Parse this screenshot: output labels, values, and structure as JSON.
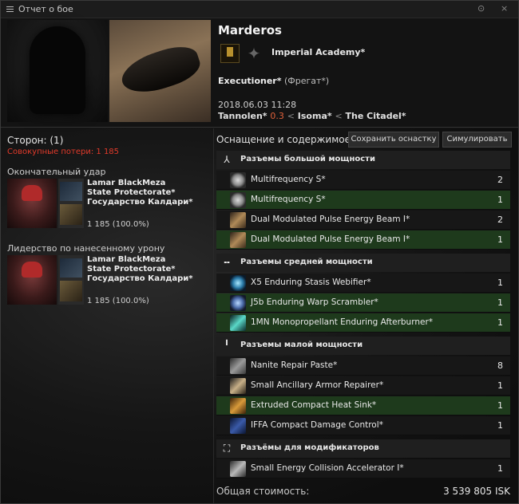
{
  "window": {
    "title": "Отчет о бое",
    "ctl1": "⊙",
    "ctl2": "×"
  },
  "victim": {
    "name": "Marderos",
    "corporation": "Imperial Academy*",
    "ship": "Executioner*",
    "ship_class": "(Фрегат*)",
    "datetime": "2018.06.03  11:28",
    "system": "Tannolen*",
    "security": "0.3",
    "constellation": "Isoma*",
    "region": "The Citadel*",
    "sep": "<"
  },
  "summary": {
    "sides": "Сторон: (1)",
    "total_losses": "Совокупные потери: 1 185"
  },
  "final_blow": {
    "heading": "Окончательный удар",
    "name": "Lamar BlackMeza",
    "corporation": "State Protectorate*",
    "alliance": "Государство Калдари*",
    "damage": "1 185 (100.0%)"
  },
  "top_damage": {
    "heading": "Лидерство по нанесенному урону",
    "name": "Lamar BlackMeza",
    "corporation": "State Protectorate*",
    "alliance": "Государство Калдари*",
    "damage": "1 185 (100.0%)"
  },
  "fitting": {
    "title": "Оснащение и содержимое",
    "save_button": "Сохранить оснастку",
    "simulate_button": "Симулировать",
    "sections": {
      "high": "Разъемы большой мощности",
      "mid": "Разъемы средней мощности",
      "low": "Разъемы малой мощности",
      "rig": "Разъёмы для модификаторов"
    },
    "items": [
      {
        "name": "Multifrequency S*",
        "qty": "2"
      },
      {
        "name": "Multifrequency S*",
        "qty": "1"
      },
      {
        "name": "Dual Modulated Pulse Energy Beam I*",
        "qty": "2"
      },
      {
        "name": "Dual Modulated Pulse Energy Beam I*",
        "qty": "1"
      },
      {
        "name": "X5 Enduring Stasis Webifier*",
        "qty": "1"
      },
      {
        "name": "J5b Enduring Warp Scrambler*",
        "qty": "1"
      },
      {
        "name": "1MN Monopropellant Enduring Afterburner*",
        "qty": "1"
      },
      {
        "name": "Nanite Repair Paste*",
        "qty": "8"
      },
      {
        "name": "Small Ancillary Armor Repairer*",
        "qty": "1"
      },
      {
        "name": "Extruded Compact Heat Sink*",
        "qty": "1"
      },
      {
        "name": "IFFA Compact Damage Control*",
        "qty": "1"
      },
      {
        "name": "Small Energy Collision Accelerator I*",
        "qty": "1"
      }
    ],
    "total_label": "Общая стоимость:",
    "total_value": "3 539 805 ISK"
  },
  "colors": {
    "highlight_row": "#1e3a1c",
    "loss_red": "#e03a2a",
    "security": "#e0603a"
  }
}
